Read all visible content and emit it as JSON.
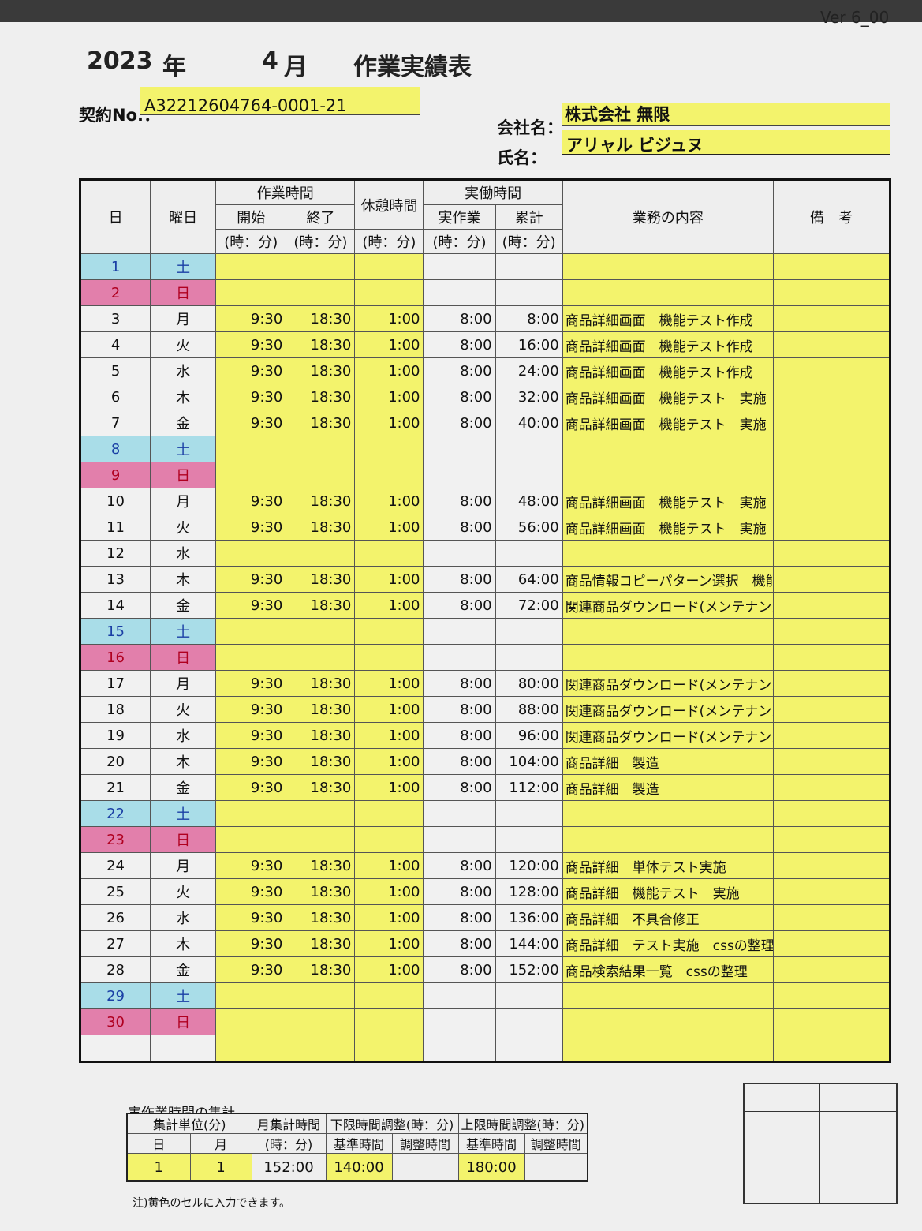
{
  "header": {
    "version": "Ver 6_00",
    "year": "2023",
    "year_unit": "年",
    "month": "4",
    "month_unit": "月",
    "title": "作業実績表",
    "contract_label": "契約No.：",
    "contract_no": "A32212604764-0001-21",
    "company_label": "会社名：",
    "company_name": "株式会社 無限",
    "name_label": "氏名：",
    "person_name": "アリャル ビジュヌ"
  },
  "table": {
    "headers": {
      "day": "日",
      "weekday": "曜日",
      "work_time": "作業時間",
      "start": "開始",
      "end": "終了",
      "break": "休憩時間",
      "actual": "実働時間",
      "actual_work": "実作業",
      "cumulative": "累計",
      "unit": "(時：分)",
      "content": "業務の内容",
      "remarks": "備　考"
    },
    "rows": [
      {
        "day": "1",
        "wd": "土",
        "type": "sat",
        "start": "",
        "end": "",
        "brk": "",
        "work": "",
        "cum": "",
        "task": ""
      },
      {
        "day": "2",
        "wd": "日",
        "type": "sun",
        "start": "",
        "end": "",
        "brk": "",
        "work": "",
        "cum": "",
        "task": ""
      },
      {
        "day": "3",
        "wd": "月",
        "type": "",
        "start": "9:30",
        "end": "18:30",
        "brk": "1:00",
        "work": "8:00",
        "cum": "8:00",
        "task": "商品詳細画面　機能テスト作成"
      },
      {
        "day": "4",
        "wd": "火",
        "type": "",
        "start": "9:30",
        "end": "18:30",
        "brk": "1:00",
        "work": "8:00",
        "cum": "16:00",
        "task": "商品詳細画面　機能テスト作成"
      },
      {
        "day": "5",
        "wd": "水",
        "type": "",
        "start": "9:30",
        "end": "18:30",
        "brk": "1:00",
        "work": "8:00",
        "cum": "24:00",
        "task": "商品詳細画面　機能テスト作成"
      },
      {
        "day": "6",
        "wd": "木",
        "type": "",
        "start": "9:30",
        "end": "18:30",
        "brk": "1:00",
        "work": "8:00",
        "cum": "32:00",
        "task": "商品詳細画面　機能テスト　実施"
      },
      {
        "day": "7",
        "wd": "金",
        "type": "",
        "start": "9:30",
        "end": "18:30",
        "brk": "1:00",
        "work": "8:00",
        "cum": "40:00",
        "task": "商品詳細画面　機能テスト　実施"
      },
      {
        "day": "8",
        "wd": "土",
        "type": "sat",
        "start": "",
        "end": "",
        "brk": "",
        "work": "",
        "cum": "",
        "task": ""
      },
      {
        "day": "9",
        "wd": "日",
        "type": "sun",
        "start": "",
        "end": "",
        "brk": "",
        "work": "",
        "cum": "",
        "task": ""
      },
      {
        "day": "10",
        "wd": "月",
        "type": "",
        "start": "9:30",
        "end": "18:30",
        "brk": "1:00",
        "work": "8:00",
        "cum": "48:00",
        "task": "商品詳細画面　機能テスト　実施"
      },
      {
        "day": "11",
        "wd": "火",
        "type": "",
        "start": "9:30",
        "end": "18:30",
        "brk": "1:00",
        "work": "8:00",
        "cum": "56:00",
        "task": "商品詳細画面　機能テスト　実施"
      },
      {
        "day": "12",
        "wd": "水",
        "type": "",
        "start": "",
        "end": "",
        "brk": "",
        "work": "",
        "cum": "",
        "task": ""
      },
      {
        "day": "13",
        "wd": "木",
        "type": "",
        "start": "9:30",
        "end": "18:30",
        "brk": "1:00",
        "work": "8:00",
        "cum": "64:00",
        "task": "商品情報コピーパターン選択　機能テスト"
      },
      {
        "day": "14",
        "wd": "金",
        "type": "",
        "start": "9:30",
        "end": "18:30",
        "brk": "1:00",
        "work": "8:00",
        "cum": "72:00",
        "task": "関連商品ダウンロード(メンテナンス用)機能テスト"
      },
      {
        "day": "15",
        "wd": "土",
        "type": "sat",
        "start": "",
        "end": "",
        "brk": "",
        "work": "",
        "cum": "",
        "task": ""
      },
      {
        "day": "16",
        "wd": "日",
        "type": "sun",
        "start": "",
        "end": "",
        "brk": "",
        "work": "",
        "cum": "",
        "task": ""
      },
      {
        "day": "17",
        "wd": "月",
        "type": "",
        "start": "9:30",
        "end": "18:30",
        "brk": "1:00",
        "work": "8:00",
        "cum": "80:00",
        "task": "関連商品ダウンロード(メンテナンス用)機能テスト"
      },
      {
        "day": "18",
        "wd": "火",
        "type": "",
        "start": "9:30",
        "end": "18:30",
        "brk": "1:00",
        "work": "8:00",
        "cum": "88:00",
        "task": "関連商品ダウンロード(メンテナンス用)機能テスト"
      },
      {
        "day": "19",
        "wd": "水",
        "type": "",
        "start": "9:30",
        "end": "18:30",
        "brk": "1:00",
        "work": "8:00",
        "cum": "96:00",
        "task": "関連商品ダウンロード(メンテナンス用)機能テスト"
      },
      {
        "day": "20",
        "wd": "木",
        "type": "",
        "start": "9:30",
        "end": "18:30",
        "brk": "1:00",
        "work": "8:00",
        "cum": "104:00",
        "task": "商品詳細　製造"
      },
      {
        "day": "21",
        "wd": "金",
        "type": "",
        "start": "9:30",
        "end": "18:30",
        "brk": "1:00",
        "work": "8:00",
        "cum": "112:00",
        "task": "商品詳細　製造"
      },
      {
        "day": "22",
        "wd": "土",
        "type": "sat",
        "start": "",
        "end": "",
        "brk": "",
        "work": "",
        "cum": "",
        "task": ""
      },
      {
        "day": "23",
        "wd": "日",
        "type": "sun",
        "start": "",
        "end": "",
        "brk": "",
        "work": "",
        "cum": "",
        "task": ""
      },
      {
        "day": "24",
        "wd": "月",
        "type": "",
        "start": "9:30",
        "end": "18:30",
        "brk": "1:00",
        "work": "8:00",
        "cum": "120:00",
        "task": "商品詳細　単体テスト実施"
      },
      {
        "day": "25",
        "wd": "火",
        "type": "",
        "start": "9:30",
        "end": "18:30",
        "brk": "1:00",
        "work": "8:00",
        "cum": "128:00",
        "task": "商品詳細　機能テスト　実施"
      },
      {
        "day": "26",
        "wd": "水",
        "type": "",
        "start": "9:30",
        "end": "18:30",
        "brk": "1:00",
        "work": "8:00",
        "cum": "136:00",
        "task": "商品詳細　不具合修正"
      },
      {
        "day": "27",
        "wd": "木",
        "type": "",
        "start": "9:30",
        "end": "18:30",
        "brk": "1:00",
        "work": "8:00",
        "cum": "144:00",
        "task": "商品詳細　テスト実施　cssの整理"
      },
      {
        "day": "28",
        "wd": "金",
        "type": "",
        "start": "9:30",
        "end": "18:30",
        "brk": "1:00",
        "work": "8:00",
        "cum": "152:00",
        "task": "商品検索結果一覧　cssの整理"
      },
      {
        "day": "29",
        "wd": "土",
        "type": "sat",
        "start": "",
        "end": "",
        "brk": "",
        "work": "",
        "cum": "",
        "task": ""
      },
      {
        "day": "30",
        "wd": "日",
        "type": "sun",
        "start": "",
        "end": "",
        "brk": "",
        "work": "",
        "cum": "",
        "task": ""
      },
      {
        "day": "",
        "wd": "",
        "type": "blank",
        "start": "",
        "end": "",
        "brk": "",
        "work": "",
        "cum": "",
        "task": ""
      }
    ]
  },
  "summary": {
    "title": "実作業時間の集計",
    "unit_header": "集計単位(分)",
    "day": "日",
    "month": "月",
    "monthly_total_header": "月集計時間",
    "hm": "(時：分)",
    "lower_header": "下限時間調整(時：分)",
    "upper_header": "上限時間調整(時：分)",
    "base_time": "基準時間",
    "adjust_time": "調整時間",
    "unit_day_value": "1",
    "unit_month_value": "1",
    "monthly_total": "152:00",
    "lower_base": "140:00",
    "lower_adjust": "",
    "upper_base": "180:00",
    "upper_adjust": ""
  },
  "note": "注)黄色のセルに入力できます。"
}
